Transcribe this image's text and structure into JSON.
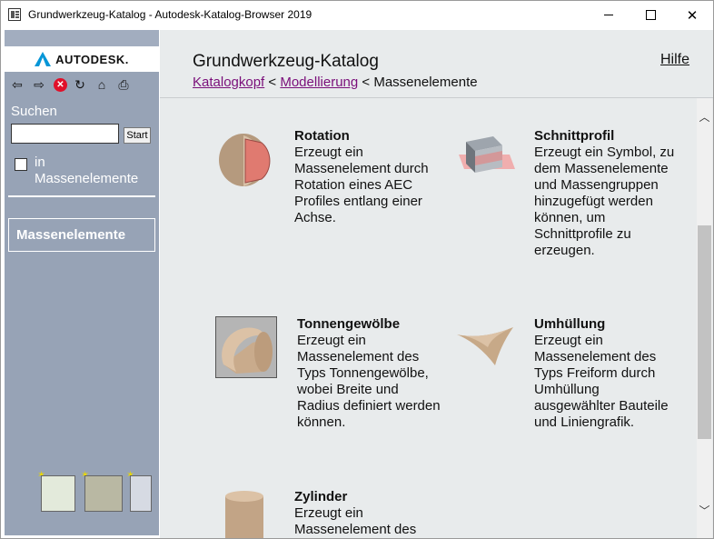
{
  "window": {
    "title": "Grundwerkzeug-Katalog - Autodesk-Katalog-Browser 2019",
    "minimize": "—",
    "maximize": "☐",
    "close": "✕"
  },
  "sidebar": {
    "logo": "AUTODESK.",
    "toolbar": [
      "back-icon",
      "forward-icon",
      "stop-icon",
      "refresh-icon",
      "home-icon",
      "print-icon"
    ],
    "search_label": "Suchen",
    "search_value": "",
    "search_button": "Start",
    "checkbox_label": "in Massenelemente",
    "nav_item": "Massenelemente"
  },
  "header": {
    "title": "Grundwerkzeug-Katalog",
    "help": "Hilfe",
    "breadcrumb": {
      "first": "Katalogkopf",
      "sep1": " < ",
      "second": "Modellierung",
      "sep2": " < ",
      "current": "Massenelemente"
    }
  },
  "items": [
    {
      "title": "Rotation",
      "desc": "Erzeugt ein Massenelement durch Rotation eines AEC Profiles entlang einer Achse."
    },
    {
      "title": "Schnittprofil",
      "desc": "Erzeugt ein Symbol, zu dem Massenelemente und Massengruppen hinzugefügt werden können, um Schnittprofile zu erzeugen."
    },
    {
      "title": "Tonnengewölbe",
      "desc": "Erzeugt ein Massenelement des Typs Tonnengewölbe, wobei Breite und Radius definiert werden können."
    },
    {
      "title": "Umhüllung",
      "desc": "Erzeugt ein Massenelement des Typs Freiform durch Umhüllung ausgewählter Bauteile und Liniengrafik."
    },
    {
      "title": "Zylinder",
      "desc": "Erzeugt ein Massenelement des"
    }
  ]
}
